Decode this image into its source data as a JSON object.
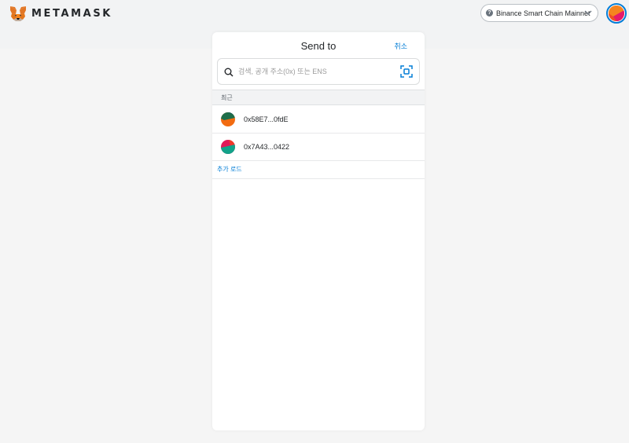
{
  "header": {
    "logo_text": "METAMASK",
    "network_label": "Binance Smart Chain Mainnet",
    "network_info_glyph": "?"
  },
  "send": {
    "title": "Send to",
    "cancel_label": "취소",
    "search_placeholder": "검색, 공개 주소(0x) 또는 ENS",
    "search_value": "",
    "recent_label": "최근",
    "recents": [
      {
        "address": "0x58E7...0fdE"
      },
      {
        "address": "0x7A43...0422"
      }
    ],
    "load_more_label": "추가 로드"
  },
  "colors": {
    "accent": "#037dd6",
    "page_bg": "#f2f3f4",
    "fox_orange": "#e2761b"
  },
  "icons": [
    "metamask-fox-icon",
    "info-icon",
    "chevron-down-icon",
    "account-avatar",
    "search-icon",
    "qr-scan-icon",
    "jazzicon"
  ]
}
